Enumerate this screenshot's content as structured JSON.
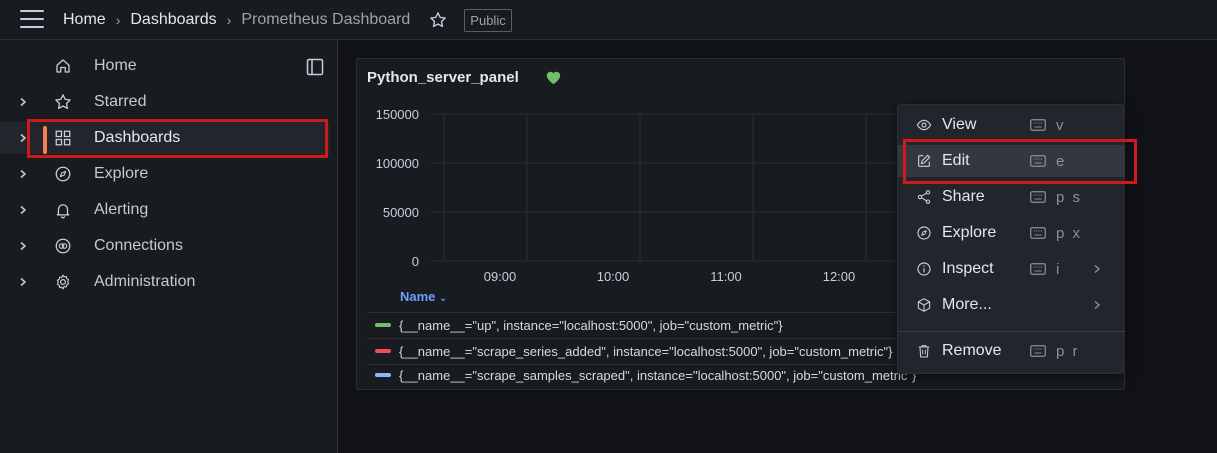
{
  "breadcrumb": {
    "home": "Home",
    "dashboards": "Dashboards",
    "current": "Prometheus Dashboard",
    "sep": "›",
    "badge": "Public"
  },
  "sidebar": {
    "items": [
      {
        "label": "Home"
      },
      {
        "label": "Starred"
      },
      {
        "label": "Dashboards"
      },
      {
        "label": "Explore"
      },
      {
        "label": "Alerting"
      },
      {
        "label": "Connections"
      },
      {
        "label": "Administration"
      }
    ],
    "active_color": "#f5814c"
  },
  "panel": {
    "title": "Python_server_panel",
    "status_color": "#73bf69",
    "legend_header": "Name",
    "legend": [
      {
        "text": "{__name__=\"up\", instance=\"localhost:5000\", job=\"custom_metric\"}",
        "color": "#73bf69"
      },
      {
        "text": "{__name__=\"scrape_series_added\", instance=\"localhost:5000\", job=\"custom_metric\"}",
        "color": "#f2495c"
      },
      {
        "text": "{__name__=\"scrape_samples_scraped\", instance=\"localhost:5000\", job=\"custom_metric\"}",
        "color": "#8ab8ff"
      }
    ]
  },
  "chart_data": {
    "type": "line",
    "yticks": [
      "150000",
      "100000",
      "50000",
      "0"
    ],
    "xticks": [
      "09:00",
      "10:00",
      "11:00",
      "12:00"
    ],
    "ylim": [
      0,
      150000
    ],
    "grid": true
  },
  "context_menu": {
    "items": [
      {
        "label": "View",
        "shortcut": "v"
      },
      {
        "label": "Edit",
        "shortcut": "e"
      },
      {
        "label": "Share",
        "shortcut": "p s"
      },
      {
        "label": "Explore",
        "shortcut": "p x"
      },
      {
        "label": "Inspect",
        "shortcut": "i"
      },
      {
        "label": "More...",
        "shortcut": ""
      },
      {
        "label": "Remove",
        "shortcut": "p r"
      }
    ]
  },
  "highlight_color": "#d0191c"
}
